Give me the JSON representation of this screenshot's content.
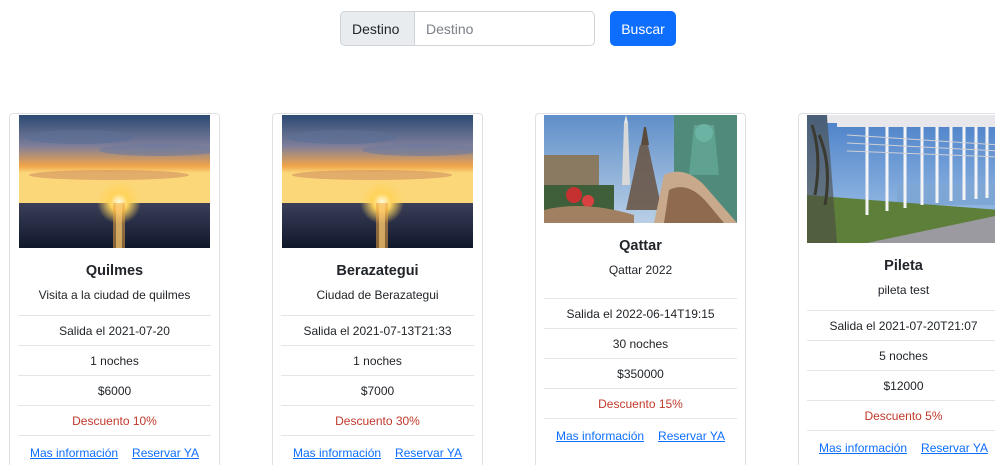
{
  "search": {
    "addon_label": "Destino",
    "placeholder": "Destino",
    "value": "",
    "button_label": "Buscar"
  },
  "cards": [
    {
      "title": "Quilmes",
      "description": "Visita a la ciudad de quilmes",
      "departure": "Salida el 2021-07-20",
      "nights": "1 noches",
      "price": "$6000",
      "discount": "Descuento 10%",
      "more_info": "Mas información",
      "book": "Reservar YA",
      "image": "sunset-sea-image"
    },
    {
      "title": "Berazategui",
      "description": "Ciudad de Berazategui",
      "departure": "Salida el 2021-07-13T21:33",
      "nights": "1 noches",
      "price": "$7000",
      "discount": "Descuento 30%",
      "more_info": "Mas información",
      "book": "Reservar YA",
      "image": "sunset-sea-image"
    },
    {
      "title": "Qattar",
      "description": "Qattar 2022",
      "departure": "Salida el 2022-06-14T19:15",
      "nights": "30 noches",
      "price": "$350000",
      "discount": "Descuento 15%",
      "more_info": "Mas información",
      "book": "Reservar YA",
      "image": "landmarks-collage-image"
    },
    {
      "title": "Pileta",
      "description": "pileta test",
      "departure": "Salida el 2021-07-20T21:07",
      "nights": "5 noches",
      "price": "$12000",
      "discount": "Descuento 5%",
      "more_info": "Mas información",
      "book": "Reservar YA",
      "image": "pergola-waterfront-image"
    }
  ],
  "colors": {
    "primary": "#0d6efd",
    "discount": "#c0392b",
    "addon_bg": "#e9ecef"
  }
}
